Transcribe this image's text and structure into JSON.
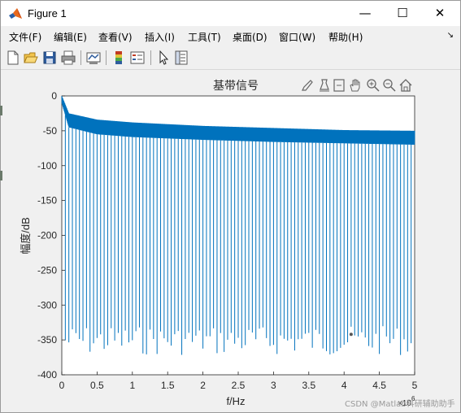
{
  "window": {
    "title": "Figure 1",
    "minimize_glyph": "—",
    "maximize_glyph": "☐",
    "close_glyph": "✕"
  },
  "menu": [
    {
      "label": "文件(F)"
    },
    {
      "label": "编辑(E)"
    },
    {
      "label": "查看(V)"
    },
    {
      "label": "插入(I)"
    },
    {
      "label": "工具(T)"
    },
    {
      "label": "桌面(D)"
    },
    {
      "label": "窗口(W)"
    },
    {
      "label": "帮助(H)"
    }
  ],
  "menu_overflow_glyph": "↘",
  "toolbar_icons": [
    "new-figure-icon",
    "open-file-icon",
    "save-icon",
    "print-icon",
    "link-plot-icon",
    "insert-colorbar-icon",
    "insert-legend-icon",
    "edit-plot-pointer-icon",
    "property-inspector-icon"
  ],
  "axes_toolbar_icons": [
    "brush-icon",
    "data-tips-icon",
    "restore-view-icon",
    "pan-icon",
    "zoom-in-icon",
    "zoom-out-icon",
    "home-icon"
  ],
  "watermark": "CSDN @Matlab科研辅助助手",
  "chart_data": {
    "type": "line",
    "title": "基带信号",
    "xlabel": "f/Hz",
    "ylabel": "幅度/dB",
    "x_exponent_label": "10",
    "x_exponent_power": "6",
    "xlim": [
      0,
      5000000
    ],
    "ylim": [
      -400,
      0
    ],
    "x_tick_labels": [
      "0",
      "0.5",
      "1",
      "1.5",
      "2",
      "2.5",
      "3",
      "3.5",
      "4",
      "4.5",
      "5"
    ],
    "y_tick_labels": [
      "0",
      "-50",
      "-100",
      "-150",
      "-200",
      "-250",
      "-300",
      "-350",
      "-400"
    ],
    "line_color": "#0072BD",
    "grid": false,
    "series": [
      {
        "envelope_upper_db": [
          [
            0,
            0
          ],
          [
            100000,
            -25
          ],
          [
            500000,
            -34
          ],
          [
            1000000,
            -38
          ],
          [
            2000000,
            -43
          ],
          [
            3000000,
            -46
          ],
          [
            4000000,
            -49
          ],
          [
            5000000,
            -50
          ]
        ],
        "envelope_lower_db": [
          [
            0,
            -10
          ],
          [
            100000,
            -45
          ],
          [
            500000,
            -55
          ],
          [
            1000000,
            -59
          ],
          [
            2000000,
            -63
          ],
          [
            3000000,
            -66
          ],
          [
            4000000,
            -68
          ],
          [
            5000000,
            -70
          ]
        ],
        "null_spacing_hz": 50000,
        "null_depth_range_db": [
          -330,
          -372
        ],
        "marker_point": [
          4100000,
          -342
        ]
      }
    ]
  }
}
